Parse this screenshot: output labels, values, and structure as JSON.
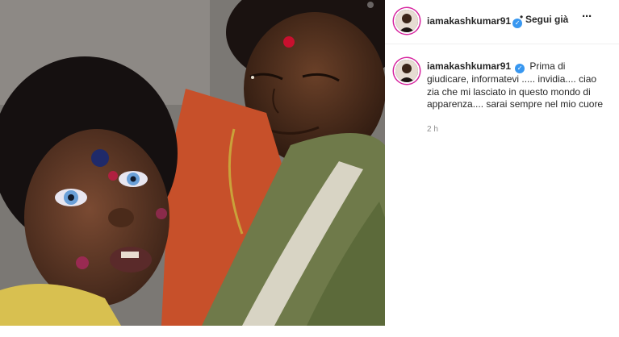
{
  "post": {
    "image_alt": "",
    "author": {
      "username": "iamakashkumar91",
      "verified": true
    },
    "follow_label": "Segui già",
    "separator": "•",
    "more_label": "···",
    "caption": {
      "username": "iamakashkumar91",
      "text": "Prima di giudicare, informatevi ..... invidia.... ciao zia che mi lasciato in questo mondo di apparenza.... sarai sempre nel mio cuore"
    },
    "time_ago": "2 h"
  },
  "colors": {
    "verified": "#3897f0",
    "story_ring": "#d6249f",
    "meta_text": "#8e8e8e"
  }
}
